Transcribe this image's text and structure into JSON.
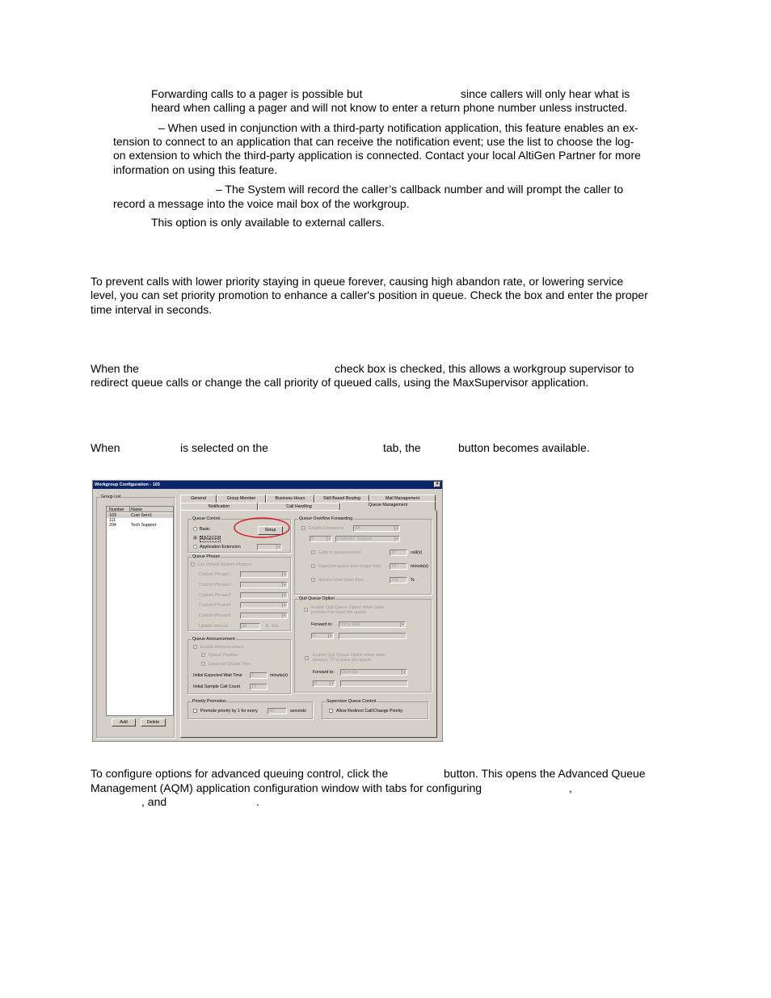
{
  "doc": {
    "p1a": "Forwarding calls to a pager is possible but",
    "p1b": "since callers will only hear what is",
    "p1c": "heard when calling a pager and will not know to enter a return phone number unless instructed.",
    "p2a": "– When used in conjunction with a third-party notification application, this feature enables an ex-",
    "p2b": "tension to connect to an application that can receive the notification event; use the list to choose the log-",
    "p2c": "on extension to which the third-party application is connected. Contact your local AltiGen Partner for more",
    "p2d": "information on using this feature.",
    "p3a": "– The System will record the caller’s callback number and will prompt the caller to",
    "p3b": "record a message into the voice mail box of the workgroup.",
    "p3c": "This option is only available to external callers.",
    "p4a": "To prevent calls with lower priority staying in queue forever, causing high abandon rate, or lowering service",
    "p4b": "level, you can set priority promotion to enhance a caller's position in queue. Check the box and enter the proper",
    "p4c": "time interval in seconds.",
    "p5a": "When the",
    "p5b": "check box is checked, this allows a workgroup supervisor to",
    "p5c": "redirect queue calls or change the call priority of queued calls, using the MaxSupervisor application.",
    "p6a": "When",
    "p6b": "is selected on the",
    "p6c": "tab, the",
    "p6d": "button becomes available.",
    "p7a": "To configure options for advanced queuing control, click the",
    "p7b": "button. This opens the Advanced Queue",
    "p7c": "Management (AQM) application configuration window with tabs for configuring",
    "p7d": ",",
    "p7e": ", and",
    "p7f": "."
  },
  "dialog": {
    "title": "Workgroup Configuration - 103",
    "close": "×",
    "group_list": "Group List",
    "col_number": "Number",
    "col_name": "Name",
    "rows": [
      {
        "num": "103",
        "name": "Cust Serv1"
      },
      {
        "num": "111",
        "name": ""
      },
      {
        "num": "204",
        "name": "Tech Support"
      }
    ],
    "add": "Add",
    "delete": "Delete",
    "tabs_row1": [
      "General",
      "Group Member",
      "Business Hours",
      "Skill Based Routing",
      "Mail Management"
    ],
    "tabs_row2": [
      "Notification",
      "Call Handling",
      "Queue Management"
    ],
    "queue_control": "Queue Control",
    "basic": "Basic",
    "advanced": "Advanced",
    "app_ext": "Application Extension",
    "setup": "Setup",
    "queue_phrase": "Queue Phrase",
    "use_default": "Use Default System Phrases",
    "phrases": [
      "Custom Phrase1",
      "Custom Phrase2",
      "Custom Phrase3",
      "Custom Phrase4",
      "Custom Phrase5"
    ],
    "update_interval": "Update Interval",
    "update_val": "30",
    "sec": "Sec",
    "queue_ann": "Queue Announcement",
    "enable_ann": "Enable Announcement",
    "queue_pos": "Queue Position",
    "exp_time": "Expected Queue Time",
    "init_wait": "Initial Expected Wait Time",
    "init_wait_val": "2",
    "minutes_c": "minute(s)",
    "init_sample": "Initial Sample Call Count",
    "init_sample_val": "10",
    "priority": "Priority Promotion",
    "promote": "Promote priority by 1 for every",
    "promote_val": "60",
    "seconds": "seconds",
    "overflow": "Queue Overflow Forwarding",
    "enable_fwd": "Enable Forward to",
    "fwd_val": "AA",
    "ext_prefix": "9",
    "ext_name": "Customer Support",
    "calls_exceed": "Calls in queue exceed",
    "calls_val": "20",
    "calls_unit": "call(s)",
    "exp_longer": "Expected queue time longer than",
    "exp_val": "10",
    "exp_unit": "minute(s)",
    "svc_lower": "Service level lower than",
    "svc_val": "100",
    "svc_unit": "%",
    "quit": "Quit Queue Option",
    "quit1a": "Enable Quit Queue Option when caller",
    "quit1b": "presses # to leave the queue",
    "forward_to": "Forward to:",
    "fwd1": "Voice Mail",
    "pre1": "9",
    "quit2a": "Enable Quit Queue Option when caller",
    "quit2b": "presses \"0\" to leave the queue",
    "fwd2": "Operator",
    "pre2": "9",
    "supervisor": "Supervisor Queue Control",
    "allow_redirect": "Allow Redirect Call/Change Priority",
    "highlight_color": "#e0141e"
  }
}
